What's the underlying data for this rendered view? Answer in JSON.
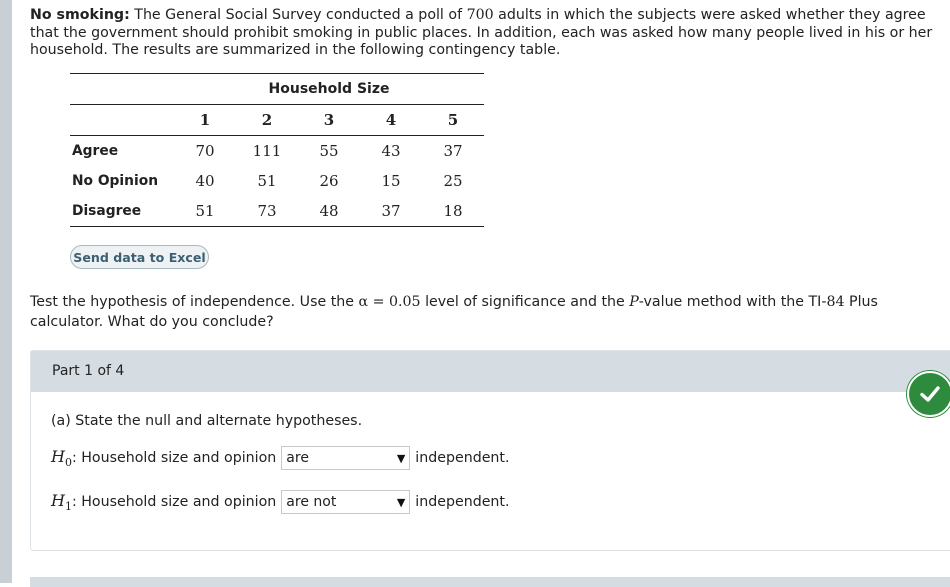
{
  "intro": {
    "lead": "No smoking:",
    "text_a": " The General Social Survey conducted a poll of ",
    "n": "700",
    "text_b": " adults in which the subjects were asked whether they agree that the government should prohibit smoking in public places. In addition, each was asked how many people lived in his or her household. The results are summarized in the following contingency table."
  },
  "table": {
    "group_title": "Household Size",
    "columns": [
      "1",
      "2",
      "3",
      "4",
      "5"
    ],
    "rows": [
      {
        "label": "Agree",
        "values": [
          "70",
          "111",
          "55",
          "43",
          "37"
        ]
      },
      {
        "label": "No Opinion",
        "values": [
          "40",
          "51",
          "26",
          "15",
          "25"
        ]
      },
      {
        "label": "Disagree",
        "values": [
          "51",
          "73",
          "48",
          "37",
          "18"
        ]
      }
    ]
  },
  "excel_button": "Send data to Excel",
  "question": {
    "a": "Test the hypothesis of independence. Use the ",
    "alpha": "α = 0.05",
    "b": " level of significance and the ",
    "p": "P",
    "c": "-value method with the TI-",
    "ti": "84",
    "d": " Plus calculator. What do you conclude?"
  },
  "part": {
    "header": "Part 1 of 4",
    "status_icon": "check-icon",
    "status_color": "#2e8b3d",
    "prompt": "(a) State the null and alternate hypotheses.",
    "h0": {
      "sym": "H",
      "sub": "0",
      "text": ": Household size and opinion",
      "selected": "are",
      "suffix": "independent."
    },
    "h1": {
      "sym": "H",
      "sub": "1",
      "text": ": Household size and opinion",
      "selected": "are not",
      "suffix": "independent."
    }
  }
}
